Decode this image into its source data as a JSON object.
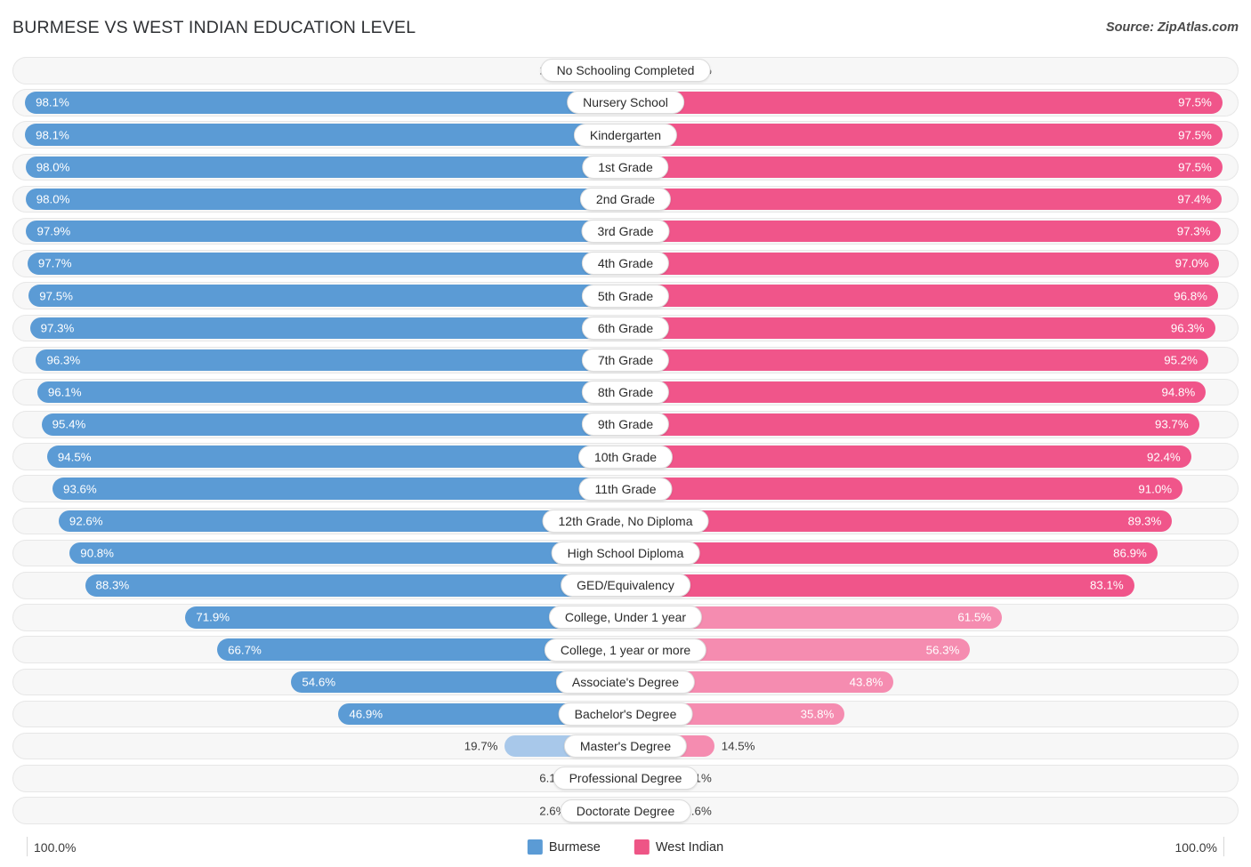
{
  "header": {
    "title": "Burmese vs West Indian Education Level",
    "source": "Source: ZipAtlas.com"
  },
  "axis": {
    "left_max": "100.0%",
    "right_max": "100.0%"
  },
  "legend": {
    "series": [
      {
        "name": "Burmese",
        "color": "#5b9bd5"
      },
      {
        "name": "West Indian",
        "color": "#ee5586"
      }
    ]
  },
  "colors": {
    "burmese_strong": "#5b9bd5",
    "burmese_light": "#a8c8ea",
    "west_indian_strong": "#f0558a",
    "west_indian_light": "#f58cb0",
    "track": "#f7f7f7",
    "track_border": "#e7e7e7"
  },
  "chart_data": {
    "type": "bar",
    "orientation": "horizontal-diverging",
    "title": "Burmese vs West Indian Education Level",
    "xlabel": "",
    "ylabel": "",
    "xlim": [
      0,
      100
    ],
    "grid": false,
    "legend_position": "bottom-center",
    "categories": [
      "No Schooling Completed",
      "Nursery School",
      "Kindergarten",
      "1st Grade",
      "2nd Grade",
      "3rd Grade",
      "4th Grade",
      "5th Grade",
      "6th Grade",
      "7th Grade",
      "8th Grade",
      "9th Grade",
      "10th Grade",
      "11th Grade",
      "12th Grade, No Diploma",
      "High School Diploma",
      "GED/Equivalency",
      "College, Under 1 year",
      "College, 1 year or more",
      "Associate's Degree",
      "Bachelor's Degree",
      "Master's Degree",
      "Professional Degree",
      "Doctorate Degree"
    ],
    "series": [
      {
        "name": "Burmese",
        "color": "#5b9bd5",
        "values": [
          1.9,
          98.1,
          98.1,
          98.0,
          98.0,
          97.9,
          97.7,
          97.5,
          97.3,
          96.3,
          96.1,
          95.4,
          94.5,
          93.6,
          92.6,
          90.8,
          88.3,
          71.9,
          66.7,
          54.6,
          46.9,
          19.7,
          6.1,
          2.6
        ]
      },
      {
        "name": "West Indian",
        "color": "#ee5586",
        "values": [
          2.5,
          97.5,
          97.5,
          97.5,
          97.4,
          97.3,
          97.0,
          96.8,
          96.3,
          95.2,
          94.8,
          93.7,
          92.4,
          91.0,
          89.3,
          86.9,
          83.1,
          61.5,
          56.3,
          43.8,
          35.8,
          14.5,
          4.1,
          1.6
        ]
      }
    ]
  },
  "rows": [
    {
      "label": "No Schooling Completed",
      "left": "1.9%",
      "right": "2.5%",
      "left_val": 1.9,
      "right_val": 2.5,
      "tone": "light"
    },
    {
      "label": "Nursery School",
      "left": "98.1%",
      "right": "97.5%",
      "left_val": 98.1,
      "right_val": 97.5,
      "tone": "strong"
    },
    {
      "label": "Kindergarten",
      "left": "98.1%",
      "right": "97.5%",
      "left_val": 98.1,
      "right_val": 97.5,
      "tone": "strong"
    },
    {
      "label": "1st Grade",
      "left": "98.0%",
      "right": "97.5%",
      "left_val": 98.0,
      "right_val": 97.5,
      "tone": "strong"
    },
    {
      "label": "2nd Grade",
      "left": "98.0%",
      "right": "97.4%",
      "left_val": 98.0,
      "right_val": 97.4,
      "tone": "strong"
    },
    {
      "label": "3rd Grade",
      "left": "97.9%",
      "right": "97.3%",
      "left_val": 97.9,
      "right_val": 97.3,
      "tone": "strong"
    },
    {
      "label": "4th Grade",
      "left": "97.7%",
      "right": "97.0%",
      "left_val": 97.7,
      "right_val": 97.0,
      "tone": "strong"
    },
    {
      "label": "5th Grade",
      "left": "97.5%",
      "right": "96.8%",
      "left_val": 97.5,
      "right_val": 96.8,
      "tone": "strong"
    },
    {
      "label": "6th Grade",
      "left": "97.3%",
      "right": "96.3%",
      "left_val": 97.3,
      "right_val": 96.3,
      "tone": "strong"
    },
    {
      "label": "7th Grade",
      "left": "96.3%",
      "right": "95.2%",
      "left_val": 96.3,
      "right_val": 95.2,
      "tone": "strong"
    },
    {
      "label": "8th Grade",
      "left": "96.1%",
      "right": "94.8%",
      "left_val": 96.1,
      "right_val": 94.8,
      "tone": "strong"
    },
    {
      "label": "9th Grade",
      "left": "95.4%",
      "right": "93.7%",
      "left_val": 95.4,
      "right_val": 93.7,
      "tone": "strong"
    },
    {
      "label": "10th Grade",
      "left": "94.5%",
      "right": "92.4%",
      "left_val": 94.5,
      "right_val": 92.4,
      "tone": "strong"
    },
    {
      "label": "11th Grade",
      "left": "93.6%",
      "right": "91.0%",
      "left_val": 93.6,
      "right_val": 91.0,
      "tone": "strong"
    },
    {
      "label": "12th Grade, No Diploma",
      "left": "92.6%",
      "right": "89.3%",
      "left_val": 92.6,
      "right_val": 89.3,
      "tone": "strong"
    },
    {
      "label": "High School Diploma",
      "left": "90.8%",
      "right": "86.9%",
      "left_val": 90.8,
      "right_val": 86.9,
      "tone": "strong"
    },
    {
      "label": "GED/Equivalency",
      "left": "88.3%",
      "right": "83.1%",
      "left_val": 88.3,
      "right_val": 83.1,
      "tone": "strong"
    },
    {
      "label": "College, Under 1 year",
      "left": "71.9%",
      "right": "61.5%",
      "left_val": 71.9,
      "right_val": 61.5,
      "tone": "mid"
    },
    {
      "label": "College, 1 year or more",
      "left": "66.7%",
      "right": "56.3%",
      "left_val": 66.7,
      "right_val": 56.3,
      "tone": "mid"
    },
    {
      "label": "Associate's Degree",
      "left": "54.6%",
      "right": "43.8%",
      "left_val": 54.6,
      "right_val": 43.8,
      "tone": "mid"
    },
    {
      "label": "Bachelor's Degree",
      "left": "46.9%",
      "right": "35.8%",
      "left_val": 46.9,
      "right_val": 35.8,
      "tone": "mid"
    },
    {
      "label": "Master's Degree",
      "left": "19.7%",
      "right": "14.5%",
      "left_val": 19.7,
      "right_val": 14.5,
      "tone": "light"
    },
    {
      "label": "Professional Degree",
      "left": "6.1%",
      "right": "4.1%",
      "left_val": 6.1,
      "right_val": 4.1,
      "tone": "light"
    },
    {
      "label": "Doctorate Degree",
      "left": "2.6%",
      "right": "1.6%",
      "left_val": 2.6,
      "right_val": 1.6,
      "tone": "light"
    }
  ]
}
